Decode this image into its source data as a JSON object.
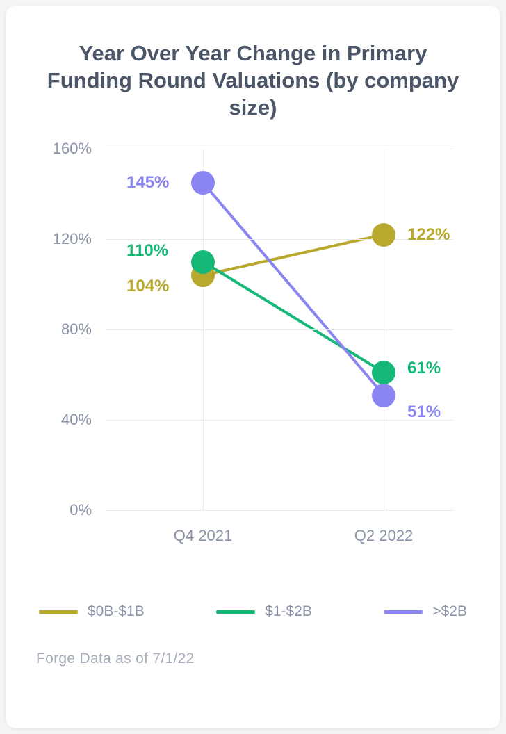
{
  "title": "Year Over Year Change in Primary Funding Round Valuations\n(by company size)",
  "footnote": "Forge Data as of 7/1/22",
  "colors": {
    "s0": "#b8a92e",
    "s1": "#16b877",
    "s2": "#8a85f0",
    "axis": "#8a94a6"
  },
  "chart_data": {
    "type": "line",
    "categories": [
      "Q4 2021",
      "Q2 2022"
    ],
    "series": [
      {
        "name": "$0B-$1B",
        "values": [
          104,
          122
        ],
        "color_key": "s0"
      },
      {
        "name": "$1-$2B",
        "values": [
          110,
          61
        ],
        "color_key": "s1"
      },
      {
        "name": ">$2B",
        "values": [
          145,
          51
        ],
        "color_key": "s2"
      }
    ],
    "ylim": [
      0,
      160
    ],
    "y_ticks": [
      0,
      40,
      80,
      120,
      160
    ],
    "y_tick_labels": [
      "0%",
      "40%",
      "80%",
      "120%",
      "160%"
    ],
    "xlabel": "",
    "ylabel": "",
    "value_suffix": "%"
  },
  "label_offsets": {
    "Q4 2021": {
      "104": {
        "dx": -110,
        "dy": 16
      },
      "110": {
        "dx": -110,
        "dy": -16
      },
      "145": {
        "dx": -110,
        "dy": 0
      }
    },
    "Q2 2022": {
      "122": {
        "dx": 34,
        "dy": 0
      },
      "61": {
        "dx": 34,
        "dy": -6
      },
      "51": {
        "dx": 34,
        "dy": 24
      }
    }
  }
}
